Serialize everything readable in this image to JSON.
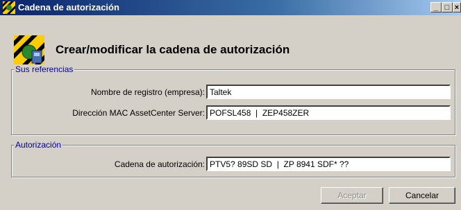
{
  "window": {
    "title": "Cadena de autorización",
    "controls": {
      "minimize": "_",
      "maximize": "□",
      "close": "×"
    }
  },
  "header": {
    "title": "Crear/modificar la cadena de autorización",
    "icon": "key-wizard-icon"
  },
  "references": {
    "legend": "Sus referencias",
    "registration_label": "Nombre de registro (empresa):",
    "registration_value": "Taltek",
    "mac_label": "Dirección MAC AssetCenter Server:",
    "mac_value": "POFSL458  |  ZEP458ZER"
  },
  "authorization": {
    "legend": "Autorización",
    "chain_label": "Cadena de autorización:",
    "chain_value": "PTV5? 89SD SD  |  ZP 8941 SDF* ??"
  },
  "buttons": {
    "accept": "Aceptar",
    "accept_enabled": false,
    "cancel": "Cancelar"
  },
  "colors": {
    "titlebar_start": "#0a246a",
    "titlebar_end": "#a6caf0",
    "legend": "#0000a8",
    "face": "#d4d0c8"
  }
}
